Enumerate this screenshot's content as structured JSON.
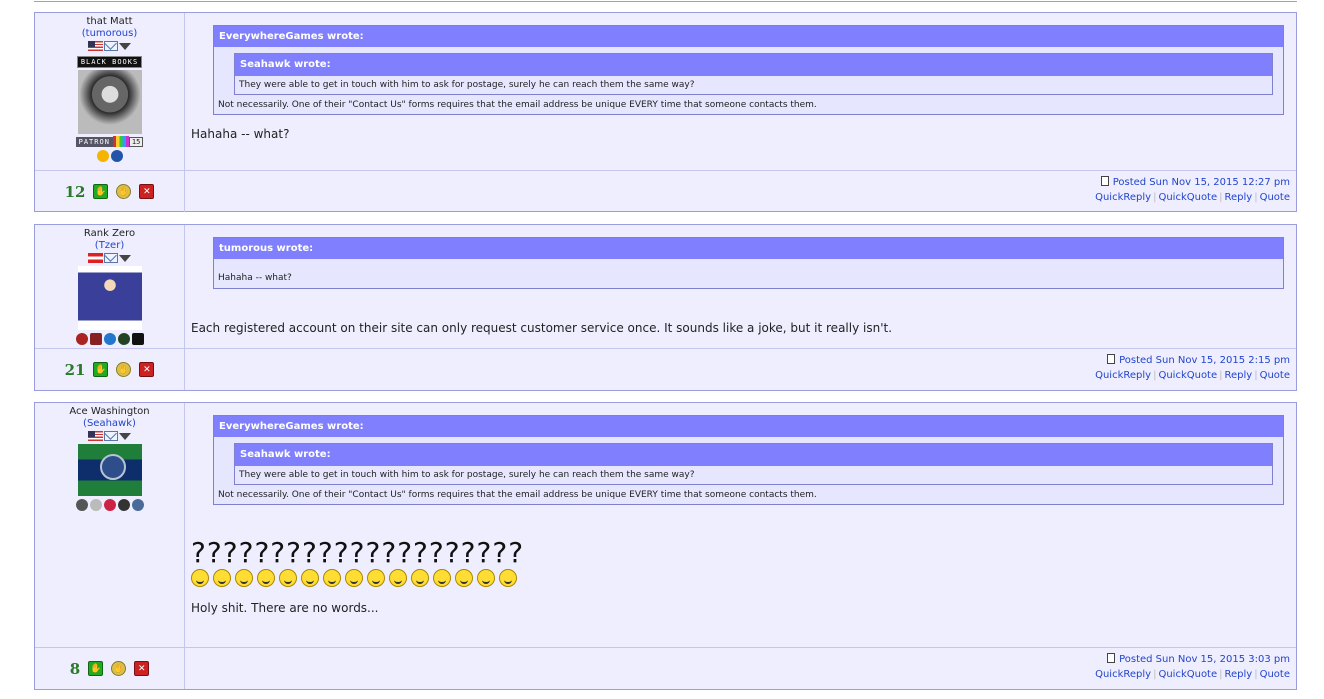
{
  "posts": [
    {
      "user": {
        "title": "that Matt",
        "username": "tumorous",
        "badge": "BLACK BOOKS",
        "patron_label": "PATRON",
        "patron_num": "15"
      },
      "quote": {
        "author": "EverywhereGames wrote:",
        "inner_author": "Seahawk wrote:",
        "inner_text": "They were able to get in touch with him to ask for postage, surely he can reach them the same way?",
        "text": "Not necessarily. One of their \"Contact Us\" forms requires that the email address be unique EVERY time that someone contacts them."
      },
      "message": "Hahaha -- what?",
      "score": "12",
      "posted": "Posted Sun Nov 15, 2015 12:27 pm",
      "actions": [
        "QuickReply",
        "QuickQuote",
        "Reply",
        "Quote"
      ]
    },
    {
      "user": {
        "title": "Rank Zero",
        "username": "Tzer"
      },
      "quote": {
        "author": "tumorous wrote:",
        "text": "Hahaha -- what?"
      },
      "message": "Each registered account on their site can only request customer service once. It sounds like a joke, but it really isn't.",
      "score": "21",
      "posted": "Posted Sun Nov 15, 2015 2:15 pm",
      "actions": [
        "QuickReply",
        "QuickQuote",
        "Reply",
        "Quote"
      ]
    },
    {
      "user": {
        "title": "Ace Washington",
        "username": "Seahawk"
      },
      "quote": {
        "author": "EverywhereGames wrote:",
        "inner_author": "Seahawk wrote:",
        "inner_text": "They were able to get in touch with him to ask for postage, surely he can reach them the same way?",
        "text": "Not necessarily. One of their \"Contact Us\" forms requires that the email address be unique EVERY time that someone contacts them."
      },
      "big_text": "?????????????????????",
      "smiley_count": 15,
      "message": "Holy shit. There are no words...",
      "score": "8",
      "posted": "Posted Sun Nov 15, 2015 3:03 pm",
      "actions": [
        "QuickReply",
        "QuickQuote",
        "Reply",
        "Quote"
      ]
    }
  ]
}
